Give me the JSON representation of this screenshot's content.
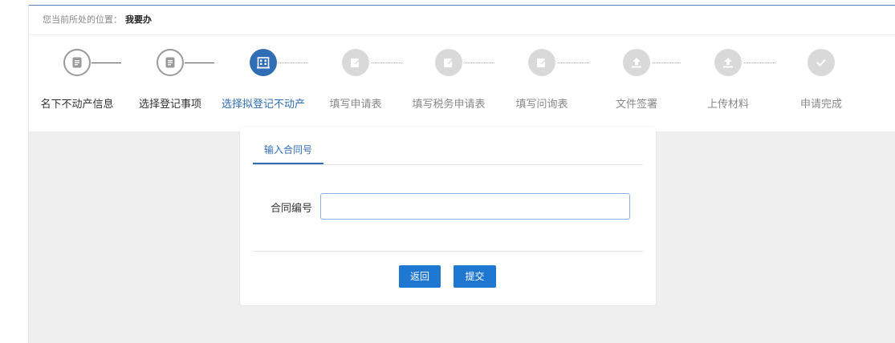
{
  "breadcrumb": {
    "prefix": "您当前所处的位置：",
    "current": "我要办"
  },
  "steps": [
    {
      "label": "名下不动产信息",
      "state": "done",
      "icon": "document-icon"
    },
    {
      "label": "选择登记事项",
      "state": "done",
      "icon": "document-icon"
    },
    {
      "label": "选择拟登记不动产",
      "state": "active",
      "icon": "building-icon"
    },
    {
      "label": "填写申请表",
      "state": "todo",
      "icon": "edit-icon"
    },
    {
      "label": "填写税务申请表",
      "state": "todo",
      "icon": "edit-icon"
    },
    {
      "label": "填写问询表",
      "state": "todo",
      "icon": "edit-icon"
    },
    {
      "label": "文件签署",
      "state": "todo",
      "icon": "upload-icon"
    },
    {
      "label": "上传材料",
      "state": "todo",
      "icon": "upload-icon"
    },
    {
      "label": "申请完成",
      "state": "todo",
      "icon": "check-icon"
    }
  ],
  "dialog": {
    "tab_label": "输入合同号",
    "field_label": "合同编号",
    "field_value": "",
    "back_label": "返回",
    "submit_label": "提交"
  },
  "colors": {
    "accent": "#2f6db5",
    "button": "#1e78d2",
    "pending": "#d9d9d9",
    "overlay": "#efefef"
  }
}
